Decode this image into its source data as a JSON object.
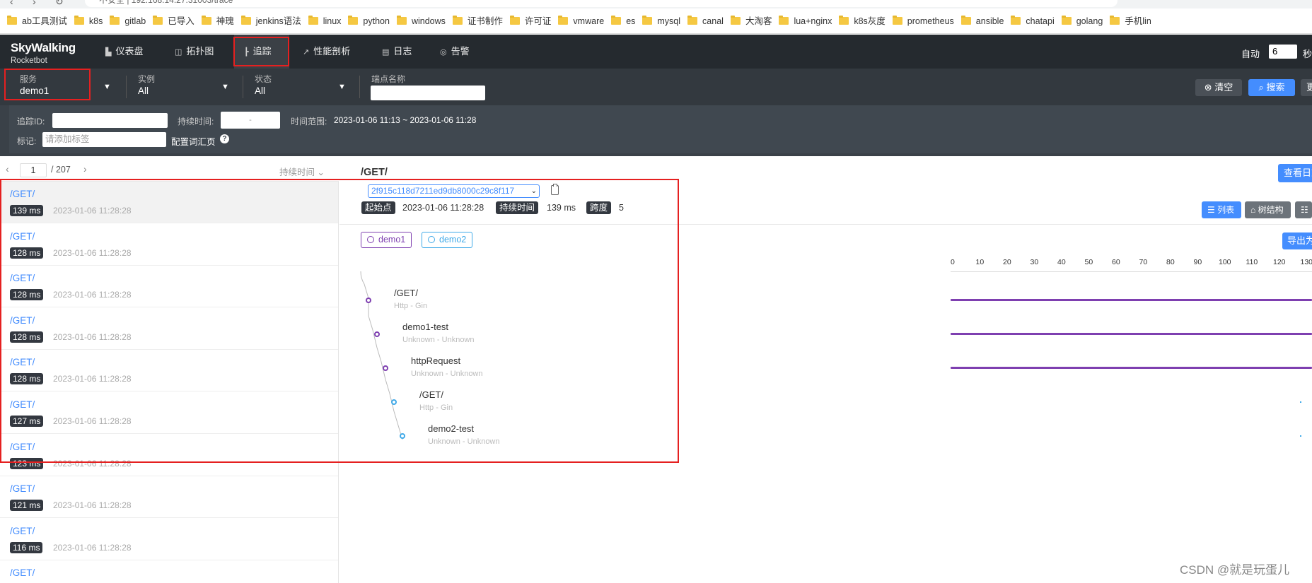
{
  "browser": {
    "address": "不安全 | 192.168.14.27:31003/trace",
    "bookmarks": [
      "ab工具测试",
      "k8s",
      "gitlab",
      "已导入",
      "神瑰",
      "jenkins语法",
      "linux",
      "python",
      "windows",
      "证书制作",
      "许可证",
      "vmware",
      "es",
      "mysql",
      "canal",
      "大淘客",
      "lua+nginx",
      "k8s灰度",
      "prometheus",
      "ansible",
      "chatapi",
      "golang",
      "手机lin"
    ]
  },
  "header": {
    "logo": "SkyWalking",
    "logo_sub": "Rocketbot",
    "nav": [
      {
        "label": "仪表盘",
        "icon": "▙"
      },
      {
        "label": "拓扑图",
        "icon": "◫"
      },
      {
        "label": "追踪",
        "icon": "┣"
      },
      {
        "label": "性能剖析",
        "icon": "↗"
      },
      {
        "label": "日志",
        "icon": "▤"
      },
      {
        "label": "告警",
        "icon": "◎"
      }
    ],
    "auto_label": "自动",
    "auto_value": "6",
    "auto_unit": "秒"
  },
  "filters": {
    "service_label": "服务",
    "service_value": "demo1",
    "instance_label": "实例",
    "instance_value": "All",
    "status_label": "状态",
    "status_value": "All",
    "endpoint_label": "端点名称",
    "clear_label": "清空",
    "search_label": "搜索",
    "more_label": "更"
  },
  "filters2": {
    "trace_id_label": "追踪ID:",
    "duration_label": "持续时间:",
    "duration_sep": "-",
    "time_range_label": "时间范围:",
    "time_range_value": "2023-01-06 11:13 ~ 2023-01-06 11:28",
    "tags_label": "标记:",
    "tags_placeholder": "请添加标签",
    "config_label": "配置词汇页"
  },
  "list": {
    "page": "1",
    "total": "/ 207",
    "sort_label": "持续时间",
    "items": [
      {
        "endpoint": "/GET/",
        "duration": "139 ms",
        "time": "2023-01-06 11:28:28"
      },
      {
        "endpoint": "/GET/",
        "duration": "128 ms",
        "time": "2023-01-06 11:28:28"
      },
      {
        "endpoint": "/GET/",
        "duration": "128 ms",
        "time": "2023-01-06 11:28:28"
      },
      {
        "endpoint": "/GET/",
        "duration": "128 ms",
        "time": "2023-01-06 11:28:28"
      },
      {
        "endpoint": "/GET/",
        "duration": "128 ms",
        "time": "2023-01-06 11:28:28"
      },
      {
        "endpoint": "/GET/",
        "duration": "127 ms",
        "time": "2023-01-06 11:28:28"
      },
      {
        "endpoint": "/GET/",
        "duration": "123 ms",
        "time": "2023-01-06 11:28:28"
      },
      {
        "endpoint": "/GET/",
        "duration": "121 ms",
        "time": "2023-01-06 11:28:28"
      },
      {
        "endpoint": "/GET/",
        "duration": "116 ms",
        "time": "2023-01-06 11:28:28"
      },
      {
        "endpoint": "/GET/",
        "duration": "",
        "time": ""
      }
    ]
  },
  "detail": {
    "title": "/GET/",
    "view_log": "查看日志",
    "trace_id": "2f915c118d7211ed9db8000c29c8f117",
    "start_label": "起始点",
    "start_value": "2023-01-06 11:28:28",
    "duration_label": "持续时间",
    "duration_value": "139 ms",
    "span_label": "跨度",
    "span_value": "5",
    "view_list": "列表",
    "view_tree": "树结构",
    "view_table": "表格",
    "export": "导出为",
    "services": [
      {
        "name": "demo1",
        "color": "#7e3fb0"
      },
      {
        "name": "demo2",
        "color": "#3fa9e8"
      }
    ],
    "axis_ticks": [
      "0",
      "10",
      "20",
      "30",
      "40",
      "50",
      "60",
      "70",
      "80",
      "90",
      "100",
      "110",
      "120",
      "130"
    ],
    "spans": [
      {
        "name": "/GET/",
        "sub": "Http - Gin",
        "bar_ms": 139,
        "service": "demo1"
      },
      {
        "name": "demo1-test",
        "sub": "Unknown - Unknown",
        "bar_ms": 139,
        "service": "demo1"
      },
      {
        "name": "httpRequest",
        "sub": "Unknown - Unknown",
        "bar_ms": 139,
        "service": "demo1"
      },
      {
        "name": "/GET/",
        "sub": "Http - Gin",
        "bar_ms": 0,
        "service": "demo2"
      },
      {
        "name": "demo2-test",
        "sub": "Unknown - Unknown",
        "bar_ms": 0,
        "service": "demo2"
      }
    ]
  },
  "watermark": "CSDN @就是玩蛋儿"
}
